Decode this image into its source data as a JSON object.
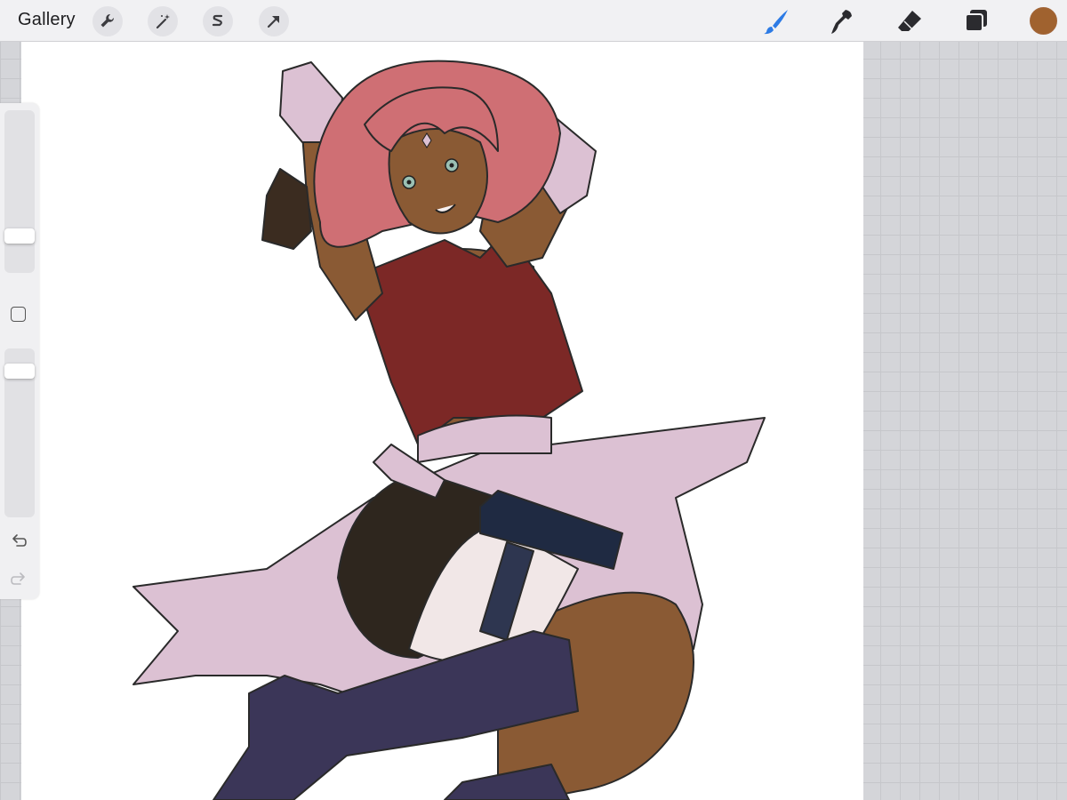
{
  "toolbar": {
    "gallery_label": "Gallery",
    "left_tools": [
      {
        "name": "actions-wrench-icon"
      },
      {
        "name": "adjustments-wand-icon"
      },
      {
        "name": "selection-icon"
      },
      {
        "name": "transform-arrow-icon"
      }
    ],
    "right_tools": [
      {
        "name": "brush-icon",
        "active": true
      },
      {
        "name": "smudge-icon"
      },
      {
        "name": "eraser-icon"
      },
      {
        "name": "layers-icon"
      }
    ],
    "current_color": "#a0622f"
  },
  "sidebar": {
    "brush_size_level": 0.2,
    "opacity_level": 0.9,
    "undo_icon": "undo-arrow-icon",
    "redo_icon": "redo-arrow-icon"
  },
  "colors": {
    "accent_blue": "#2d7be5",
    "hair_pink": "#cf6f74",
    "skin_brown": "#8a5a34",
    "top_red": "#7c2826",
    "sash_pink": "#dcc1d3",
    "boot_navy": "#3b3658",
    "shorts_dark": "#2e261e"
  }
}
